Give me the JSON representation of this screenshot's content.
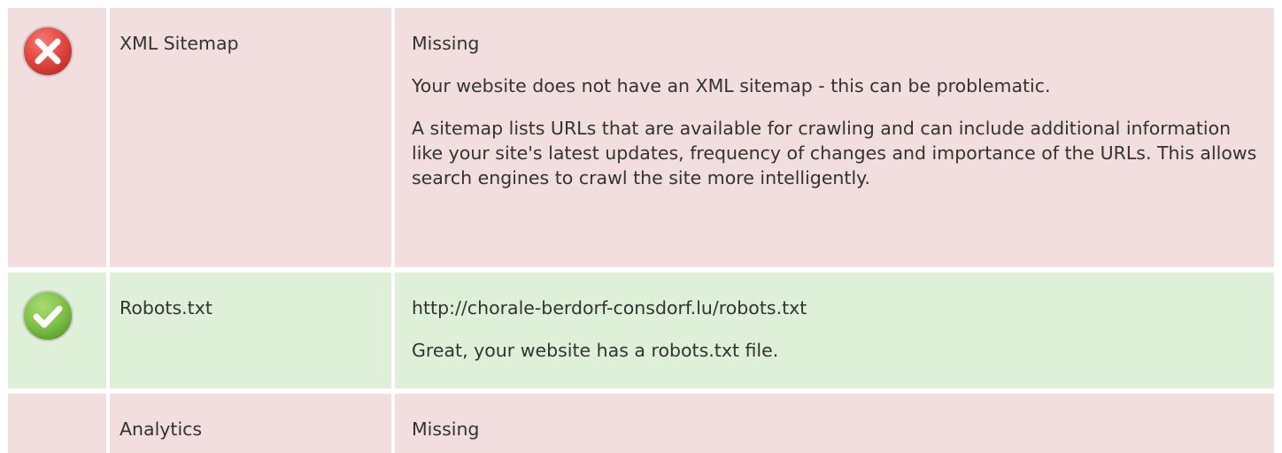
{
  "rows": [
    {
      "icon": "error-cross-icon",
      "name": "XML Sitemap",
      "status": "Missing",
      "paragraphs": [
        "Your website does not have an XML sitemap - this can be problematic.",
        "A sitemap lists URLs that are available for crawling and can include additional information like your site's latest updates, frequency of changes and importance of the URLs. This allows search engines to crawl the site more intelligently."
      ]
    },
    {
      "icon": "success-check-icon",
      "name": "Robots.txt",
      "status": "http://chorale-berdorf-consdorf.lu/robots.txt",
      "paragraphs": [
        "Great, your website has a robots.txt file."
      ]
    },
    {
      "icon": "",
      "name": "Analytics",
      "status": "Missing",
      "paragraphs": []
    }
  ],
  "colors": {
    "error_background": "#f2dede",
    "success_background": "#dff0d8",
    "error_icon": "#e0443e",
    "success_icon": "#7cc046",
    "text": "#333333"
  }
}
